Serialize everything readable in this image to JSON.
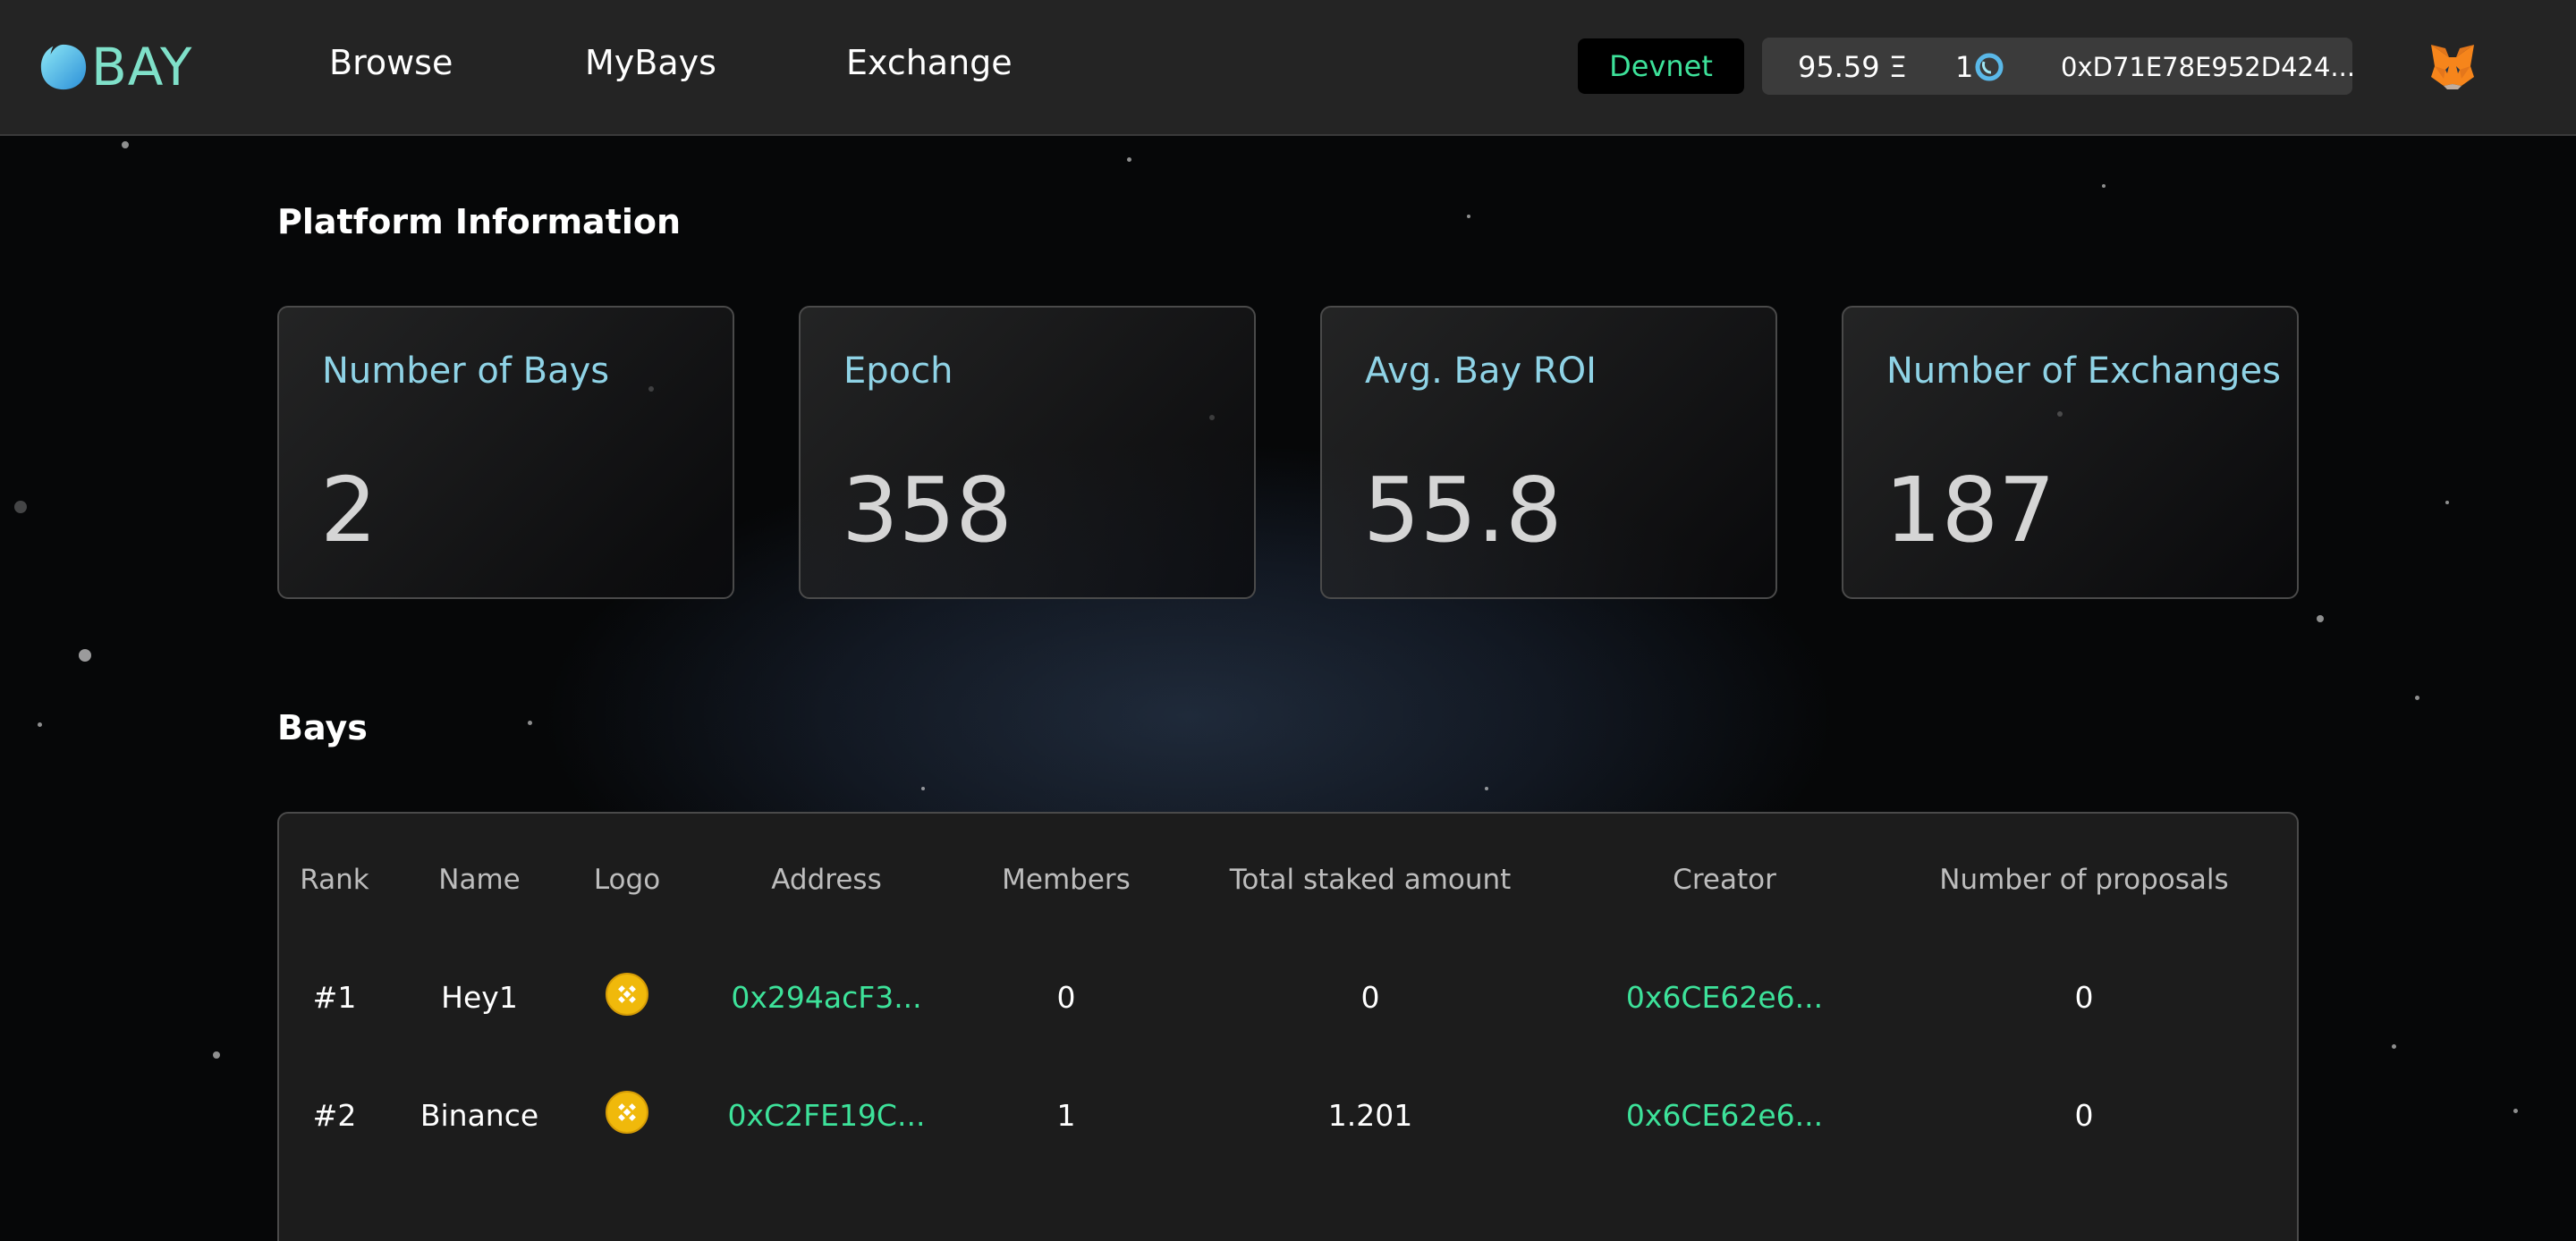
{
  "header": {
    "logo_text": "BAY",
    "nav": [
      "Browse",
      "MyBays",
      "Exchange"
    ],
    "network": "Devnet",
    "wallet": {
      "eth_balance": "95.59 Ξ",
      "token_balance": "1",
      "address": "0xD71E78E952D424..."
    }
  },
  "platform": {
    "title": "Platform Information",
    "cards": [
      {
        "label": "Number of Bays",
        "value": "2"
      },
      {
        "label": "Epoch",
        "value": "358"
      },
      {
        "label": "Avg. Bay ROI",
        "value": "55.8"
      },
      {
        "label": "Number of Exchanges",
        "value": "187"
      }
    ]
  },
  "bays": {
    "title": "Bays",
    "columns": [
      "Rank",
      "Name",
      "Logo",
      "Address",
      "Members",
      "Total staked amount",
      "Creator",
      "Number of proposals"
    ],
    "rows": [
      {
        "rank": "#1",
        "name": "Hey1",
        "logo": "binance-coin-icon",
        "address": "0x294acF3...",
        "members": "0",
        "staked": "0",
        "creator": "0x6CE62e6...",
        "proposals": "0"
      },
      {
        "rank": "#2",
        "name": "Binance",
        "logo": "binance-coin-icon",
        "address": "0xC2FE19C...",
        "members": "1",
        "staked": "1.201",
        "creator": "0x6CE62e6...",
        "proposals": "0"
      }
    ]
  },
  "colors": {
    "accent_green": "#3de29a",
    "label_blue": "#8fd3e6",
    "logo_teal": "#7fe0c9"
  }
}
